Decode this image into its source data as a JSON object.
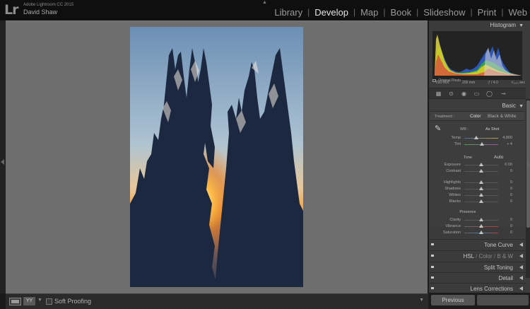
{
  "identity": {
    "logo": "Lr",
    "app_name": "Adobe Lightroom CC 2015",
    "user_name": "David Shaw"
  },
  "modules": [
    {
      "label": "Library",
      "active": false
    },
    {
      "label": "Develop",
      "active": true
    },
    {
      "label": "Map",
      "active": false
    },
    {
      "label": "Book",
      "active": false
    },
    {
      "label": "Slideshow",
      "active": false
    },
    {
      "label": "Print",
      "active": false
    },
    {
      "label": "Web",
      "active": false
    }
  ],
  "toolbar": {
    "view_icon": "loupe-view-icon",
    "compare_label": "YY",
    "soft_proofing_label": "Soft Proofing"
  },
  "histogram": {
    "title": "Histogram",
    "iso": "ISO 800",
    "focal": "200 mm",
    "aperture": "ƒ / 4.0",
    "shutter": "¹⁄₁₆₀₀ sec",
    "original_photo_label": "Original Photo"
  },
  "basic": {
    "title": "Basic",
    "treatment_label": "Treatment :",
    "treatment_color": "Color",
    "treatment_bw": "Black & White",
    "wb_label": "WB :",
    "wb_value": "As Shot",
    "tone_label": "Tone",
    "auto_label": "Auto",
    "presence_label": "Presence",
    "sliders": {
      "temp": {
        "label": "Temp",
        "value": "4,800",
        "level": 0.35
      },
      "tint": {
        "label": "Tint",
        "value": "+ 4",
        "level": 0.52
      },
      "exposure": {
        "label": "Exposure",
        "value": "0.00",
        "level": 0.5
      },
      "contrast": {
        "label": "Contrast",
        "value": "0",
        "level": 0.5
      },
      "highlights": {
        "label": "Highlights",
        "value": "0",
        "level": 0.5
      },
      "shadows": {
        "label": "Shadows",
        "value": "0",
        "level": 0.5
      },
      "whites": {
        "label": "Whites",
        "value": "0",
        "level": 0.5
      },
      "blacks": {
        "label": "Blacks",
        "value": "0",
        "level": 0.5
      },
      "clarity": {
        "label": "Clarity",
        "value": "0",
        "level": 0.5
      },
      "vibrance": {
        "label": "Vibrance",
        "value": "0",
        "level": 0.5
      },
      "saturation": {
        "label": "Saturation",
        "value": "0",
        "level": 0.5
      }
    }
  },
  "panels": {
    "tone_curve": "Tone Curve",
    "hsl": "HSL",
    "color": "Color",
    "bw": "B & W",
    "split_toning": "Split Toning",
    "detail": "Detail",
    "lens_corrections": "Lens Corrections"
  },
  "nav": {
    "previous_label": "Previous"
  },
  "colors": {
    "canvas_bg": "#6e6e6e",
    "panel_bg": "#3b3b3b",
    "active_module": "#e6e6e6"
  }
}
